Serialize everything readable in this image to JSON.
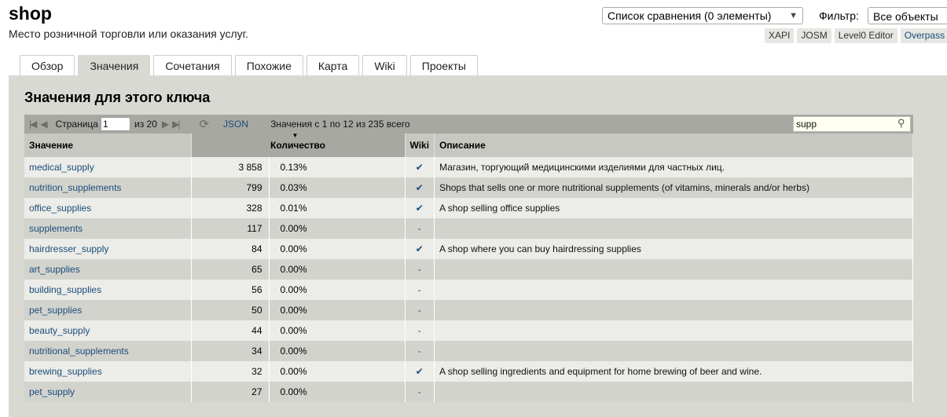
{
  "header": {
    "title": "shop",
    "subtitle": "Место розничной торговли или оказания услуг.",
    "compare_list": "Список сравнения (0 элементы)",
    "filter_label": "Фильтр:",
    "filter_value": "Все объекты"
  },
  "ext_links": [
    "XAPI",
    "JOSM",
    "Level0 Editor",
    "Overpass"
  ],
  "tabs": [
    "Обзор",
    "Значения",
    "Сочетания",
    "Похожие",
    "Карта",
    "Wiki",
    "Проекты"
  ],
  "active_tab": "Значения",
  "section_title": "Значения для этого ключа",
  "pager": {
    "page_label": "Страница",
    "page_value": "1",
    "of_total": "из 20",
    "json": "JSON",
    "range_text": "Значения с 1 по 12 из 235 всего",
    "search_value": "supp"
  },
  "columns": {
    "value": "Значение",
    "count": "Количество",
    "wiki": "Wiki",
    "description": "Описание"
  },
  "rows": [
    {
      "value": "medical_supply",
      "count": "3 858",
      "pct": "0.13%",
      "wiki": "✔",
      "desc": "Магазин, торгующий медицинскими изделиями для частных лиц."
    },
    {
      "value": "nutrition_supplements",
      "count": "799",
      "pct": "0.03%",
      "wiki": "✔",
      "desc": "Shops that sells one or more nutritional supplements (of vitamins, minerals and/or herbs)"
    },
    {
      "value": "office_supplies",
      "count": "328",
      "pct": "0.01%",
      "wiki": "✔",
      "desc": "A shop selling office supplies"
    },
    {
      "value": "supplements",
      "count": "117",
      "pct": "0.00%",
      "wiki": "-",
      "desc": ""
    },
    {
      "value": "hairdresser_supply",
      "count": "84",
      "pct": "0.00%",
      "wiki": "✔",
      "desc": "A shop where you can buy hairdressing supplies"
    },
    {
      "value": "art_supplies",
      "count": "65",
      "pct": "0.00%",
      "wiki": "-",
      "desc": ""
    },
    {
      "value": "building_supplies",
      "count": "56",
      "pct": "0.00%",
      "wiki": "-",
      "desc": ""
    },
    {
      "value": "pet_supplies",
      "count": "50",
      "pct": "0.00%",
      "wiki": "-",
      "desc": ""
    },
    {
      "value": "beauty_supply",
      "count": "44",
      "pct": "0.00%",
      "wiki": "-",
      "desc": ""
    },
    {
      "value": "nutritional_supplements",
      "count": "34",
      "pct": "0.00%",
      "wiki": "-",
      "desc": ""
    },
    {
      "value": "brewing_supplies",
      "count": "32",
      "pct": "0.00%",
      "wiki": "✔",
      "desc": "A shop selling ingredients and equipment for home brewing of beer and wine."
    },
    {
      "value": "pet_supply",
      "count": "27",
      "pct": "0.00%",
      "wiki": "-",
      "desc": ""
    }
  ]
}
